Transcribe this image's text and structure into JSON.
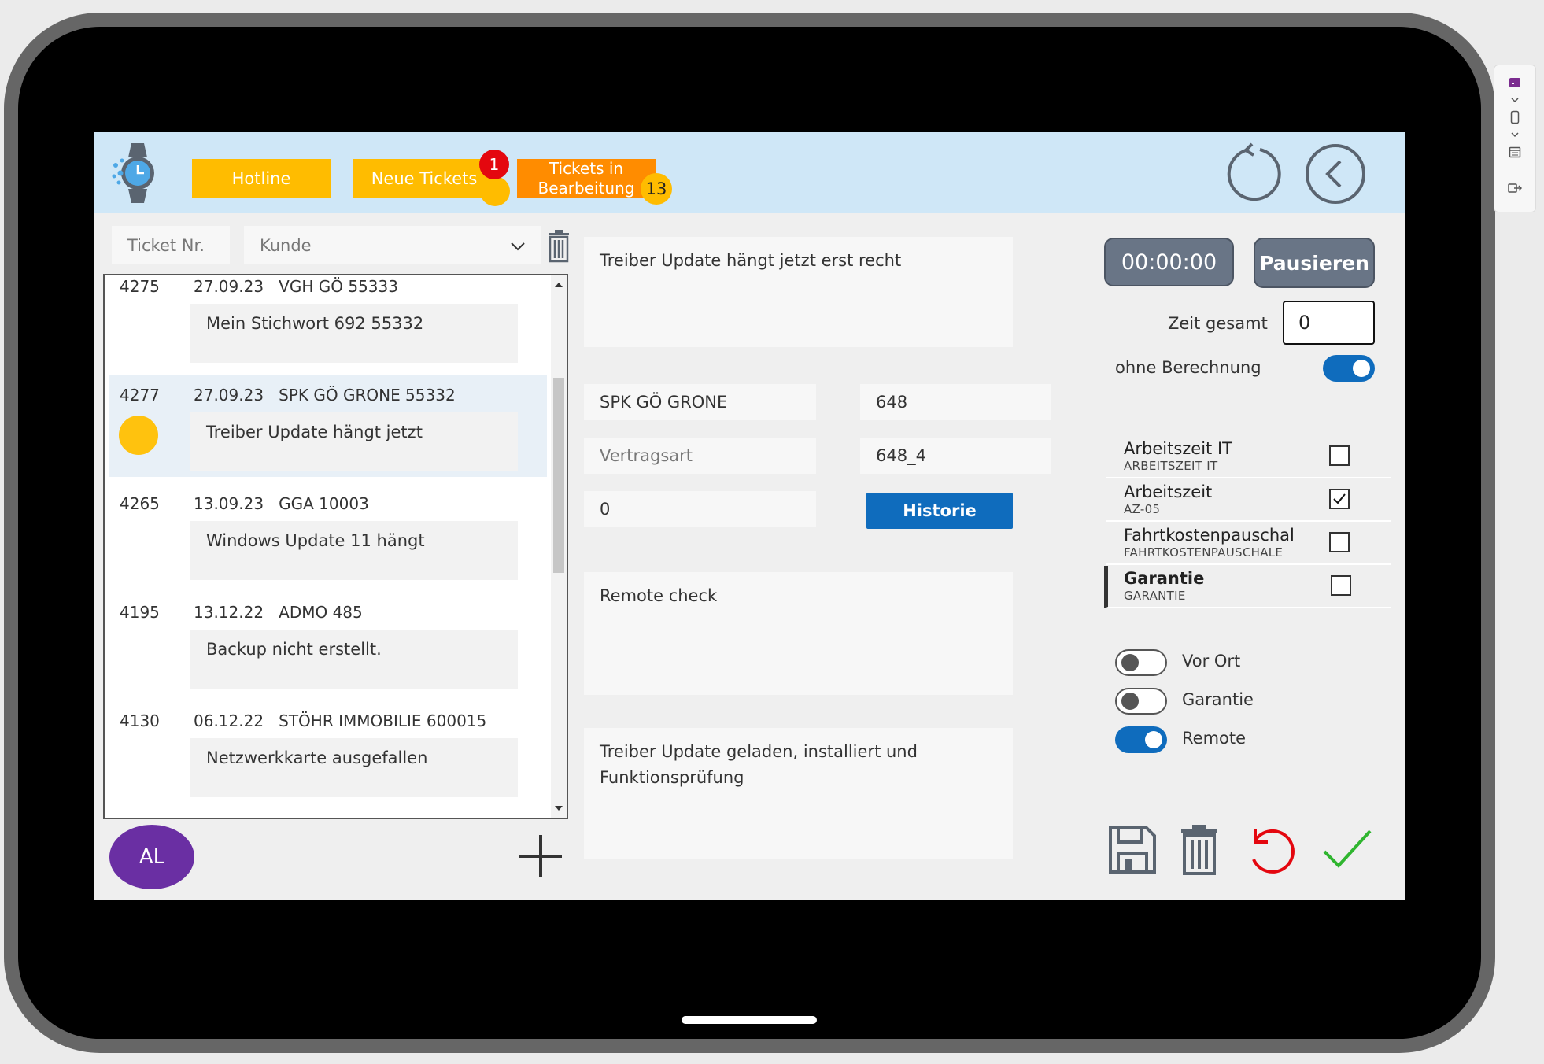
{
  "header": {
    "tabs": [
      {
        "label": "Hotline"
      },
      {
        "label": "Neue Tickets",
        "badge": "1"
      },
      {
        "label": "Tickets in Bearbeitung",
        "badge": "13"
      }
    ]
  },
  "filter": {
    "ticket_placeholder": "Ticket Nr.",
    "customer_placeholder": "Kunde"
  },
  "tickets": [
    {
      "id": "4275",
      "date": "27.09.23",
      "customer": "VGH GÖ 55333",
      "description": "Mein Stichwort  692 55332"
    },
    {
      "id": "4277",
      "date": "27.09.23",
      "customer": "SPK GÖ GRONE 55332",
      "description": "Treiber Update hängt jetzt"
    },
    {
      "id": "4265",
      "date": "13.09.23",
      "customer": "GGA 10003",
      "description": "Windows Update 11 hängt"
    },
    {
      "id": "4195",
      "date": "13.12.22",
      "customer": "ADMO 485",
      "description": "Backup nicht erstellt."
    },
    {
      "id": "4130",
      "date": "06.12.22",
      "customer": "STÖHR IMMOBILIE 600015",
      "description": "Netzwerkkarte ausgefallen"
    }
  ],
  "user": {
    "initials": "AL"
  },
  "detail": {
    "subject": "Treiber Update hängt jetzt erst recht",
    "customer": "SPK GÖ GRONE",
    "customer_no": "648",
    "contract_placeholder": "Vertragsart",
    "contract_no": "648_4",
    "value": "0",
    "history_button": "Historie",
    "note": "Remote check",
    "solution": "Treiber Update geladen, installiert und Funktionsprüfung"
  },
  "timer": {
    "time": "00:00:00",
    "pause_button": "Pausieren",
    "total_label": "Zeit gesamt",
    "total_value": "0",
    "no_charge_label": "ohne Berechnung"
  },
  "options": [
    {
      "title": "Arbeitszeit IT",
      "code": "ARBEITSZEIT IT",
      "checked": false
    },
    {
      "title": "Arbeitszeit",
      "code": "AZ-05",
      "checked": true
    },
    {
      "title": "Fahrtkostenpauschal",
      "code": "FAHRTKOSTENPAUSCHALE",
      "checked": false
    },
    {
      "title": "Garantie",
      "code": "GARANTIE",
      "checked": false
    }
  ],
  "toggles": [
    {
      "label": "Vor Ort",
      "on": false
    },
    {
      "label": "Garantie",
      "on": false
    },
    {
      "label": "Remote",
      "on": true
    }
  ],
  "colors": {
    "header_bg": "#cfe7f7",
    "tab_yellow": "#ffbc00",
    "tab_orange": "#ff8c00",
    "badge_red": "#e4070f",
    "primary_blue": "#0f6cbd",
    "avatar_purple": "#6a2fa3",
    "undo_red": "#e4070f",
    "confirm_green": "#2fb52f"
  }
}
